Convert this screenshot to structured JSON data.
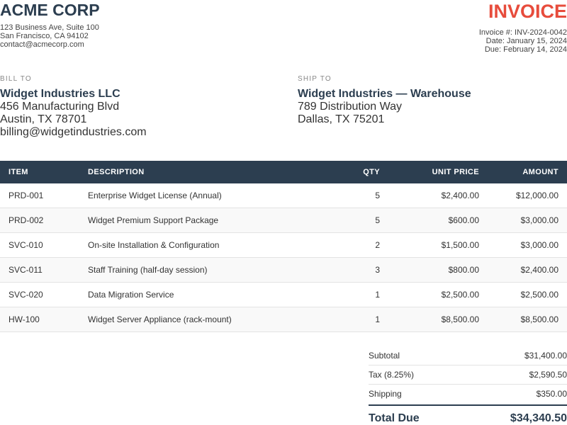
{
  "company": {
    "name": "ACME CORP",
    "address_lines": [
      "123 Business Ave, Suite 100",
      "San Francisco, CA 94102",
      "contact@acmecorp.com"
    ]
  },
  "invoice": {
    "title": "INVOICE",
    "meta_lines": [
      "Invoice #: INV-2024-0042",
      "Date: January 15, 2024",
      "Due: February 14, 2024"
    ]
  },
  "bill_to": {
    "label": "BILL TO",
    "name": "Widget Industries LLC",
    "lines": [
      "456 Manufacturing Blvd",
      "Austin, TX 78701",
      "billing@widgetindustries.com"
    ]
  },
  "ship_to": {
    "label": "SHIP TO",
    "name": "Widget Industries — Warehouse",
    "lines": [
      "789 Distribution Way",
      "Dallas, TX 75201"
    ]
  },
  "table": {
    "headers": {
      "item": "ITEM",
      "description": "DESCRIPTION",
      "qty": "QTY",
      "unit_price": "UNIT PRICE",
      "amount": "AMOUNT"
    },
    "rows": [
      {
        "item": "PRD-001",
        "description": "Enterprise Widget License (Annual)",
        "qty": "5",
        "unit_price": "$2,400.00",
        "amount": "$12,000.00"
      },
      {
        "item": "PRD-002",
        "description": "Widget Premium Support Package",
        "qty": "5",
        "unit_price": "$600.00",
        "amount": "$3,000.00"
      },
      {
        "item": "SVC-010",
        "description": "On-site Installation & Configuration",
        "qty": "2",
        "unit_price": "$1,500.00",
        "amount": "$3,000.00"
      },
      {
        "item": "SVC-011",
        "description": "Staff Training (half-day session)",
        "qty": "3",
        "unit_price": "$800.00",
        "amount": "$2,400.00"
      },
      {
        "item": "SVC-020",
        "description": "Data Migration Service",
        "qty": "1",
        "unit_price": "$2,500.00",
        "amount": "$2,500.00"
      },
      {
        "item": "HW-100",
        "description": "Widget Server Appliance (rack-mount)",
        "qty": "1",
        "unit_price": "$8,500.00",
        "amount": "$8,500.00"
      }
    ]
  },
  "totals": {
    "subtotal_label": "Subtotal",
    "subtotal_value": "$31,400.00",
    "tax_label": "Tax (8.25%)",
    "tax_value": "$2,590.50",
    "shipping_label": "Shipping",
    "shipping_value": "$350.00",
    "total_label": "Total Due",
    "total_value": "$34,340.50"
  },
  "colors": {
    "brand": "#2c3e50",
    "accent": "#e74c3c"
  }
}
